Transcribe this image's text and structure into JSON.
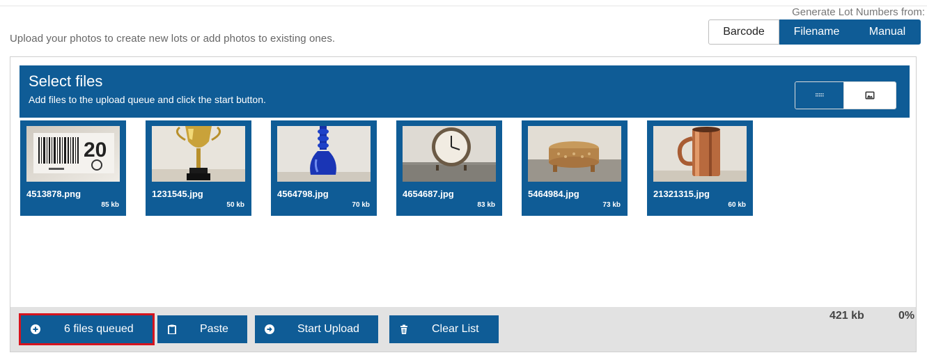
{
  "intro_text": "Upload your photos to create new lots or add photos to existing ones.",
  "lot_numbers": {
    "label": "Generate Lot Numbers from:",
    "options": [
      "Barcode",
      "Filename",
      "Manual"
    ],
    "selected": "Filename"
  },
  "header": {
    "title": "Select files",
    "subtitle": "Add files to the upload queue and click the start button."
  },
  "view_toggle": {
    "list_icon": "list-icon",
    "grid_icon": "image-icon",
    "selected": "image"
  },
  "files": [
    {
      "name": "4513878.png",
      "size": "85 kb",
      "subject": "barcode-label"
    },
    {
      "name": "1231545.jpg",
      "size": "50 kb",
      "subject": "gold-trophy"
    },
    {
      "name": "4564798.jpg",
      "size": "70 kb",
      "subject": "blue-glass-bottle"
    },
    {
      "name": "4654687.jpg",
      "size": "83 kb",
      "subject": "alarm-clock"
    },
    {
      "name": "5464984.jpg",
      "size": "73 kb",
      "subject": "ornate-box"
    },
    {
      "name": "21321315.jpg",
      "size": "60 kb",
      "subject": "copper-mug"
    }
  ],
  "footer": {
    "queue_label": "6 files queued",
    "paste_label": "Paste",
    "start_label": "Start Upload",
    "clear_label": "Clear List",
    "total_size": "421 kb",
    "progress": "0%"
  },
  "colors": {
    "brand": "#0f5c96",
    "highlight": "#d6141e",
    "footer_bg": "#e2e2e2"
  }
}
